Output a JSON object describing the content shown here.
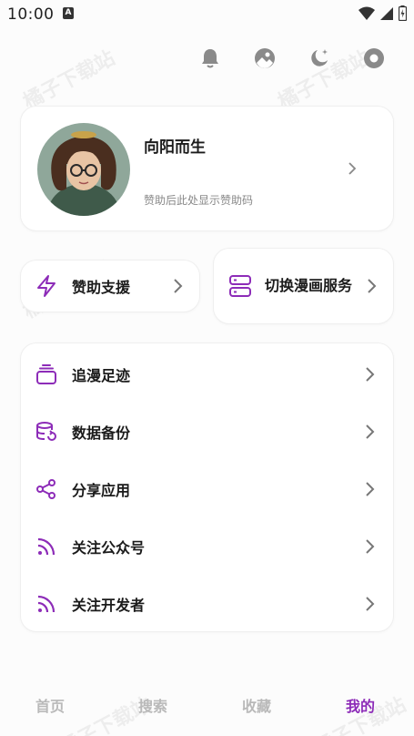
{
  "status_bar": {
    "time": "10:00",
    "a_label": "A"
  },
  "profile": {
    "name": "向阳而生",
    "subtitle": "赞助后此处显示赞助码"
  },
  "actions": {
    "sponsor_label": "赞助支援",
    "switch_label": "切换漫画服务"
  },
  "menu": {
    "items": [
      {
        "label": "追漫足迹",
        "icon": "layers-icon"
      },
      {
        "label": "数据备份",
        "icon": "database-sync-icon"
      },
      {
        "label": "分享应用",
        "icon": "share-icon"
      },
      {
        "label": "关注公众号",
        "icon": "rss-icon"
      },
      {
        "label": "关注开发者",
        "icon": "rss-icon"
      }
    ]
  },
  "bottom_nav": {
    "items": [
      "首页",
      "搜索",
      "收藏",
      "我的"
    ],
    "active": "我的"
  },
  "watermark": "橘子下载站",
  "colors": {
    "accent": "#8d2cb8",
    "icon_gray": "#8a8a8a"
  }
}
